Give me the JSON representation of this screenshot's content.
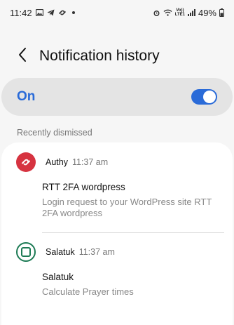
{
  "status_bar": {
    "time": "11:42",
    "battery": "49%",
    "lte_top": "Vo))",
    "lte_bottom": "LTE1"
  },
  "header": {
    "title": "Notification history"
  },
  "toggle": {
    "label": "On",
    "state": "on",
    "accent_color": "#2a6bd8"
  },
  "section": {
    "label": "Recently dismissed"
  },
  "notifications": [
    {
      "app": "Authy",
      "time": "11:37 am",
      "title": "RTT 2FA wordpress",
      "body": "Login request to your WordPress site RTT 2FA wordpress",
      "icon": "authy-icon",
      "icon_color": "#d63340"
    },
    {
      "app": "Salatuk",
      "time": "11:37 am",
      "title": "Salatuk",
      "body": "Calculate Prayer times",
      "icon": "salatuk-icon",
      "icon_color": "#1d7b55"
    }
  ]
}
